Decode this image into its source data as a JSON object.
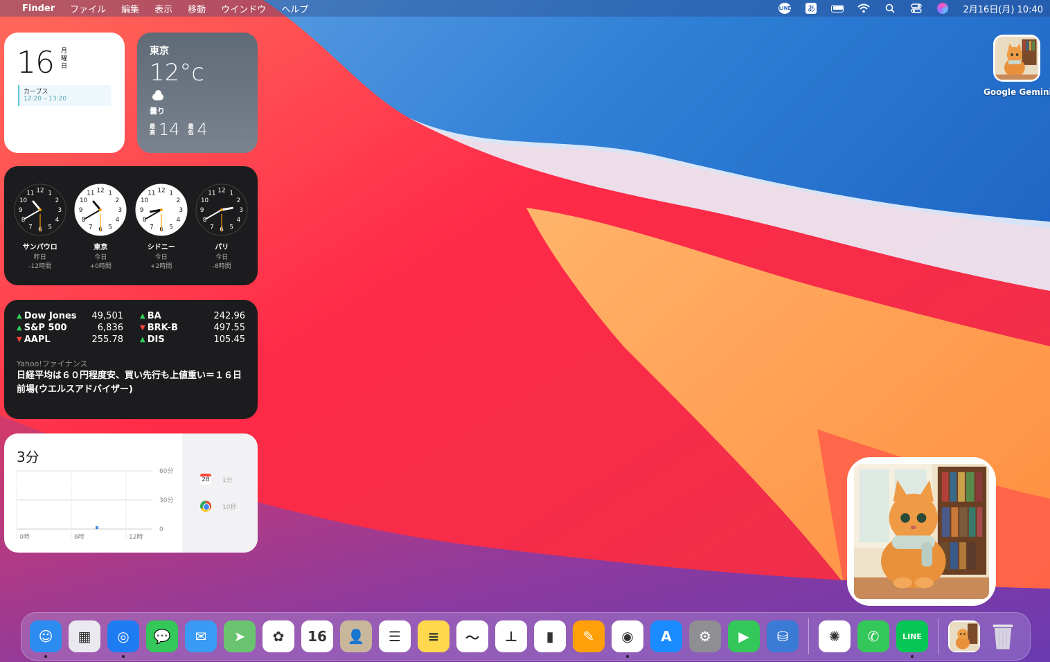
{
  "menubar": {
    "app_name": "Finder",
    "menus": [
      "ファイル",
      "編集",
      "表示",
      "移動",
      "ウインドウ",
      "ヘルプ"
    ],
    "line_badge": "LINE",
    "ime_char": "あ",
    "datetime": "2月16日(月) 10:40"
  },
  "calendar_widget": {
    "day_number": "16",
    "weekday_vertical": "月曜日",
    "event_title": "カーブス",
    "event_time": "12:20 – 13:20"
  },
  "weather_widget": {
    "city": "東京",
    "temperature": "12°c",
    "condition": "曇り",
    "high_label": "最高",
    "high": "14",
    "low_label": "最低",
    "low": "4"
  },
  "world_clock_widget": {
    "clocks": [
      {
        "city": "サンパウロ",
        "day": "昨日",
        "offset": "-12時間",
        "dark": true,
        "hour": 10.67,
        "minute": 40
      },
      {
        "city": "東京",
        "day": "今日",
        "offset": "+0時間",
        "dark": false,
        "hour": 10.67,
        "minute": 40
      },
      {
        "city": "シドニー",
        "day": "今日",
        "offset": "+2時間",
        "dark": false,
        "hour": 8.67,
        "minute": 40
      },
      {
        "city": "パリ",
        "day": "今日",
        "offset": "-8時間",
        "dark": true,
        "hour": 2.67,
        "minute": 40
      }
    ]
  },
  "stocks_widget": {
    "rows": [
      [
        {
          "sym": "Dow Jones",
          "val": "49,501",
          "dir": "up"
        },
        {
          "sym": "BA",
          "val": "242.96",
          "dir": "up"
        }
      ],
      [
        {
          "sym": "S&P 500",
          "val": "6,836",
          "dir": "up"
        },
        {
          "sym": "BRK-B",
          "val": "497.55",
          "dir": "down"
        }
      ],
      [
        {
          "sym": "AAPL",
          "val": "255.78",
          "dir": "down"
        },
        {
          "sym": "DIS",
          "val": "105.45",
          "dir": "up"
        }
      ]
    ],
    "news_source": "Yahoo!ファイナンス",
    "news_headline": "日経平均は６０円程度安、買い先行も上値重い＝１６日前場(ウエルスアドバイザー)"
  },
  "screentime_widget": {
    "total": "3分",
    "y_ticks": [
      "60分",
      "30分",
      "0"
    ],
    "x_ticks": [
      "0時",
      "6時",
      "12時"
    ],
    "apps": [
      {
        "icon": "calendar-icon",
        "label": "1分",
        "cal_day": "28"
      },
      {
        "icon": "chrome-icon",
        "label": "10秒"
      }
    ]
  },
  "desktop": {
    "icon_label": "Google Gemini"
  },
  "dock": {
    "apps": [
      {
        "name": "finder",
        "color": "#2d8cf0",
        "glyph": "☺",
        "running": true
      },
      {
        "name": "launchpad",
        "color": "#e9e9ef",
        "glyph": "▦",
        "running": false
      },
      {
        "name": "safari",
        "color": "#1e7cf2",
        "glyph": "◎",
        "running": true
      },
      {
        "name": "messages",
        "color": "#34c759",
        "glyph": "💬",
        "running": false
      },
      {
        "name": "mail",
        "color": "#3a9bf5",
        "glyph": "✉",
        "running": false
      },
      {
        "name": "maps",
        "color": "#6ac46f",
        "glyph": "➤",
        "running": false
      },
      {
        "name": "photos",
        "color": "#ffffff",
        "glyph": "✿",
        "running": false
      },
      {
        "name": "calendar",
        "color": "#ffffff",
        "glyph": "16",
        "running": false
      },
      {
        "name": "contacts",
        "color": "#c9b79c",
        "glyph": "👤",
        "running": false
      },
      {
        "name": "reminders",
        "color": "#ffffff",
        "glyph": "☰",
        "running": false
      },
      {
        "name": "notes",
        "color": "#ffd84d",
        "glyph": "≡",
        "running": false
      },
      {
        "name": "freeform",
        "color": "#ffffff",
        "glyph": "〜",
        "running": false
      },
      {
        "name": "keynote",
        "color": "#ffffff",
        "glyph": "⊥",
        "running": false
      },
      {
        "name": "numbers",
        "color": "#ffffff",
        "glyph": "▮",
        "running": false
      },
      {
        "name": "pages",
        "color": "#ff9f0a",
        "glyph": "✎",
        "running": false
      },
      {
        "name": "chrome",
        "color": "#ffffff",
        "glyph": "◉",
        "running": true
      },
      {
        "name": "app-store",
        "color": "#1a8cff",
        "glyph": "A",
        "running": false
      },
      {
        "name": "system-settings",
        "color": "#8e8e93",
        "glyph": "⚙",
        "running": false
      },
      {
        "name": "facetime",
        "color": "#34c759",
        "glyph": "▶",
        "running": false
      },
      {
        "name": "disk-utility",
        "color": "#3a7bd5",
        "glyph": "⛁",
        "running": false
      }
    ],
    "apps_after_sep": [
      {
        "name": "chatgpt",
        "color": "#ffffff",
        "glyph": "✺",
        "running": false
      },
      {
        "name": "phone",
        "color": "#34c759",
        "glyph": "✆",
        "running": false
      },
      {
        "name": "line",
        "color": "#06c755",
        "glyph": "LINE",
        "running": true
      }
    ]
  }
}
